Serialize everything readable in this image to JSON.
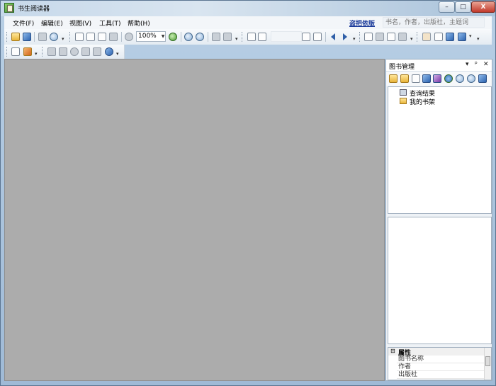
{
  "window": {
    "title": "书生阅读器",
    "close_glyph": "X",
    "min_glyph": "–",
    "max_glyph": "□"
  },
  "menubar": {
    "items": [
      {
        "label": "文件(F)"
      },
      {
        "label": "编辑(E)"
      },
      {
        "label": "视图(V)"
      },
      {
        "label": "工具(T)"
      },
      {
        "label": "帮助(H)"
      }
    ],
    "rights_link": "盗把依版",
    "search_placeholder": "书名，作者，出版社，主题词"
  },
  "toolbar": {
    "zoom_value": "100%"
  },
  "panel": {
    "title": "图书管理",
    "pin_glyph": "ᵖ",
    "close_glyph": "✕",
    "menu_glyph": "▾",
    "tree": [
      {
        "label": "查询结果",
        "icon": "search-results-icon"
      },
      {
        "label": "我的书架",
        "icon": "folder-icon"
      }
    ],
    "properties": {
      "section": "属性",
      "rows": [
        "图书名称",
        "作者",
        "出版社"
      ]
    }
  },
  "colors": {
    "document_background": "#acacac",
    "link": "#1a3a9a",
    "close_button": "#c2392b"
  }
}
